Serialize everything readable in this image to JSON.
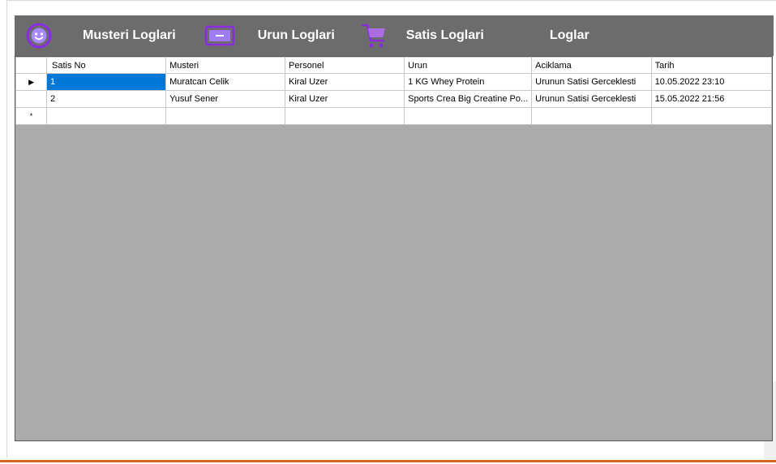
{
  "nav": {
    "musteri": {
      "label": "Musteri Loglari"
    },
    "urun": {
      "label": "Urun Loglari"
    },
    "satis": {
      "label": "Satis Loglari"
    },
    "loglar": {
      "label": "Loglar"
    }
  },
  "grid": {
    "columns": [
      "Satis No",
      "Musteri",
      "Personel",
      "Urun",
      "Aciklama",
      "Tarih"
    ],
    "rows": [
      {
        "indicator": "▶",
        "cells": [
          "1",
          "Muratcan Celik",
          "Kiral Uzer",
          "1 KG Whey Protein",
          "Urunun Satisi Gerceklesti",
          "10.05.2022 23:10"
        ]
      },
      {
        "indicator": "",
        "cells": [
          "2",
          "Yusuf Sener",
          "Kiral Uzer",
          "Sports Crea Big Creatine Po...",
          "Urunun Satisi Gerceklesti",
          "15.05.2022 21:56"
        ]
      }
    ],
    "new_row_indicator": "*"
  },
  "colors": {
    "toolbar": "#6c6c6c",
    "grid_background": "#ababab",
    "selection": "#0078d7",
    "accent_purple": "#8a2be2",
    "bottom_line": "#d2691e"
  }
}
